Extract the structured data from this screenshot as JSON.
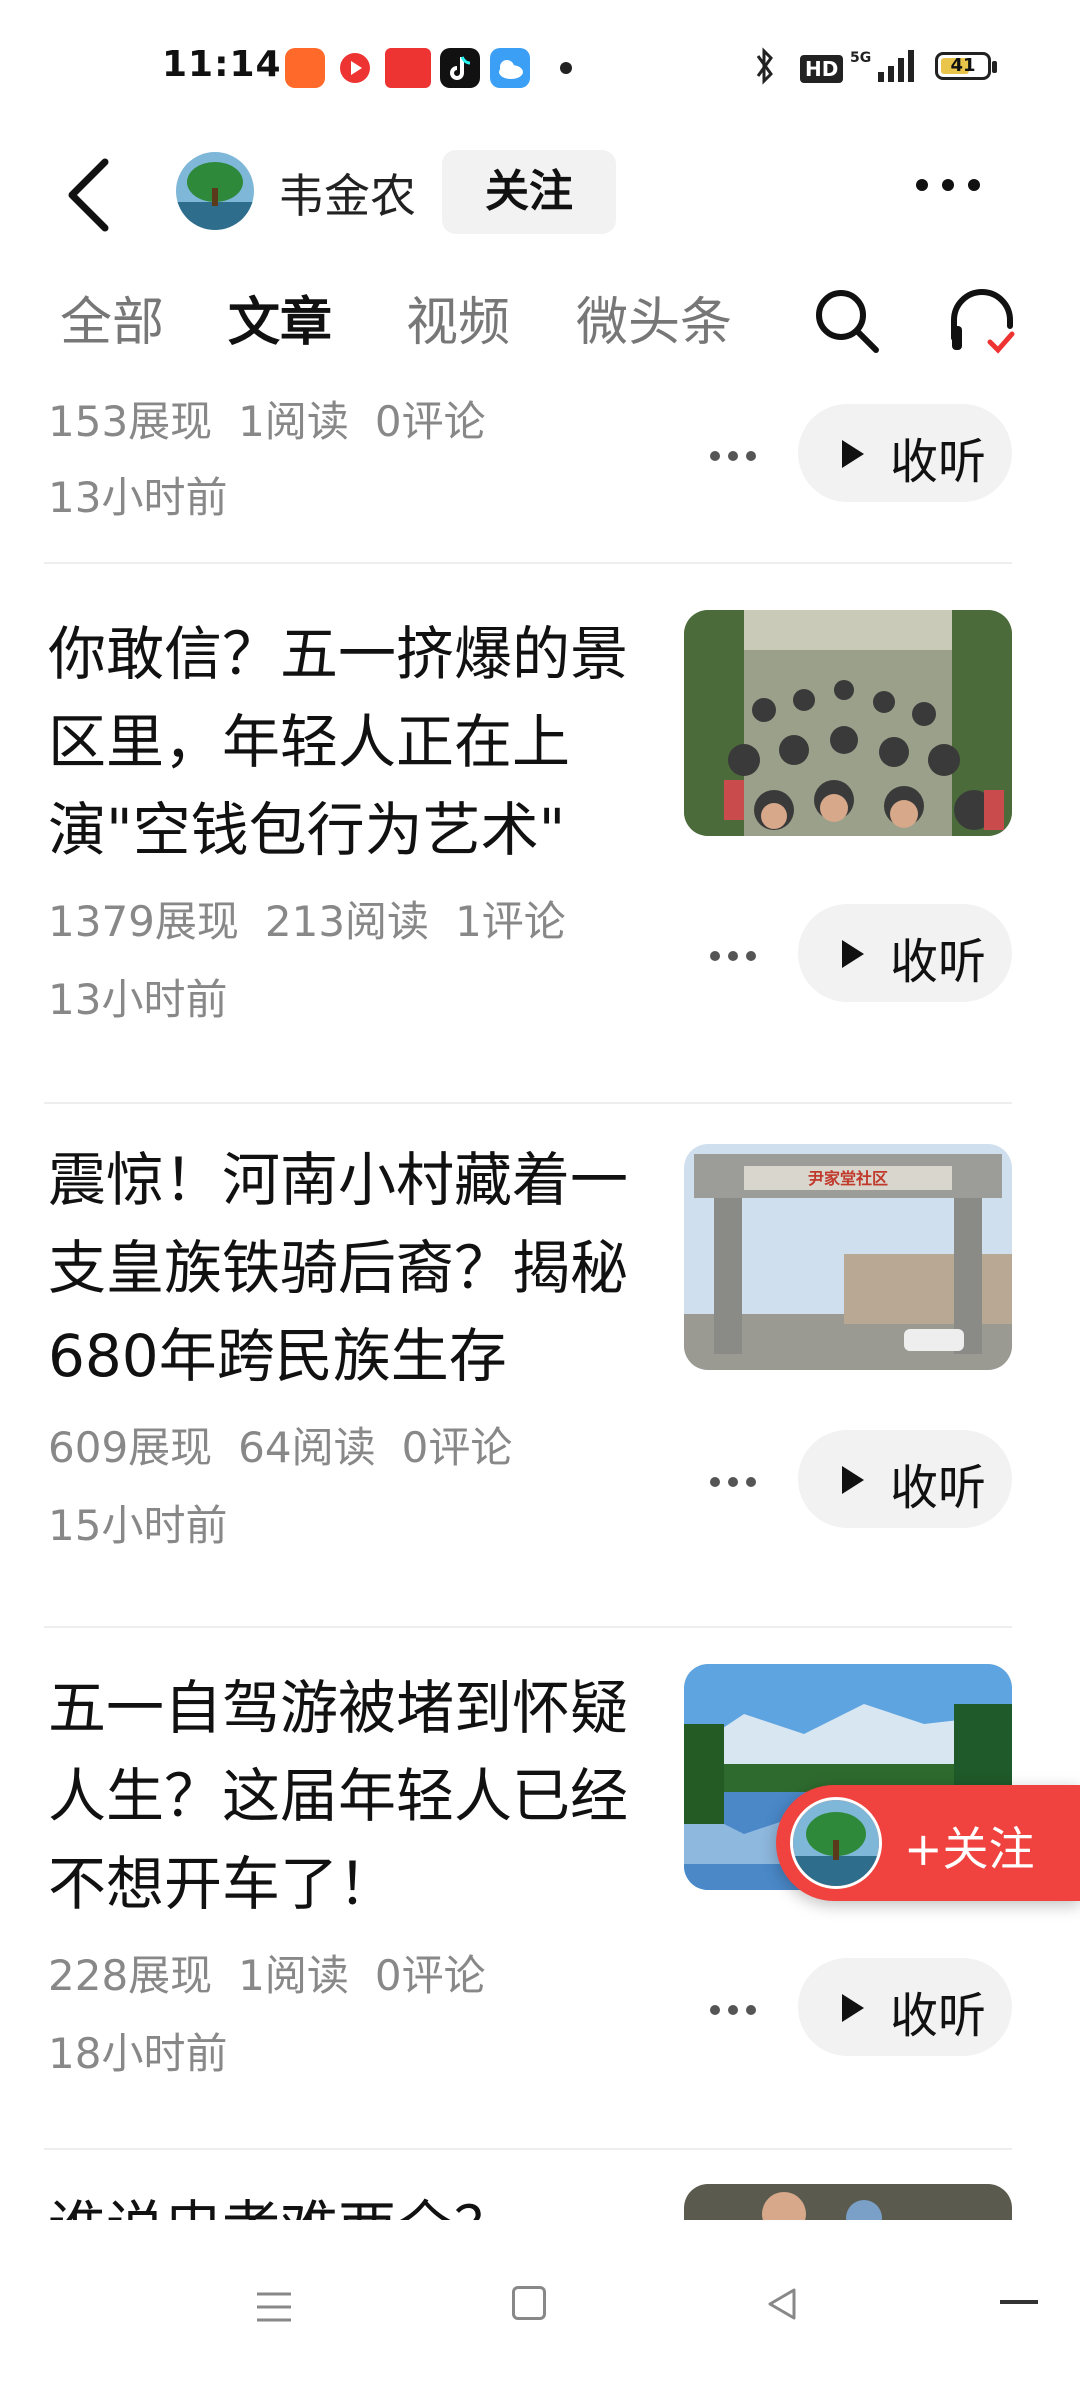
{
  "status_bar": {
    "time": "11:14",
    "battery": "41",
    "network": "5G",
    "hd": "HD",
    "app_icons": [
      "kuaishou-icon",
      "video-icon",
      "toutiao-icon",
      "tiktok-icon",
      "weather-icon"
    ]
  },
  "header": {
    "author_name": "韦金农",
    "follow_label": "关注"
  },
  "tabs": [
    {
      "label": "全部",
      "active": false
    },
    {
      "label": "文章",
      "active": true
    },
    {
      "label": "视频",
      "active": false
    },
    {
      "label": "微头条",
      "active": false
    }
  ],
  "articles": [
    {
      "title": "",
      "views": "153展现",
      "reads": "1阅读",
      "comments": "0评论",
      "time": "13小时前",
      "listen_label": "收听"
    },
    {
      "title": "你敢信？五一挤爆的景区里，年轻人正在上演\"空钱包行为艺术\"",
      "views": "1379展现",
      "reads": "213阅读",
      "comments": "1评论",
      "time": "13小时前",
      "listen_label": "收听"
    },
    {
      "title": "震惊！河南小村藏着一支皇族铁骑后裔？揭秘680年跨民族生存",
      "views": "609展现",
      "reads": "64阅读",
      "comments": "0评论",
      "time": "15小时前",
      "listen_label": "收听"
    },
    {
      "title": "五一自驾游被堵到怀疑人生？这届年轻人已经不想开车了！",
      "views": "228展现",
      "reads": "1阅读",
      "comments": "0评论",
      "time": "18小时前",
      "listen_label": "收听"
    },
    {
      "title": "谁说忠孝难两全？"
    }
  ],
  "float_follow": {
    "label": "+关注"
  },
  "gate_sign": "尹家堂社区"
}
